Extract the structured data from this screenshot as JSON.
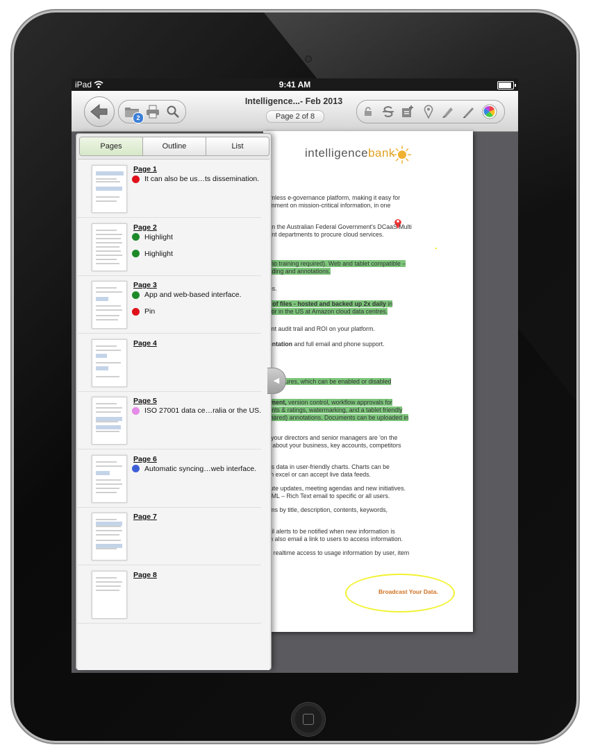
{
  "status": {
    "carrier": "iPad",
    "time": "9:41 AM"
  },
  "toolbar": {
    "title": "Intelligence...- Feb 2013",
    "page_indicator": "Page 2 of 8",
    "files_badge": "2"
  },
  "panel": {
    "tabs": [
      {
        "label": "Pages",
        "active": true
      },
      {
        "label": "Outline",
        "active": false
      },
      {
        "label": "List",
        "active": false
      }
    ],
    "pages": [
      {
        "label": "Page 1",
        "annotations": [
          {
            "text": "It can also be us…ts dissemination.",
            "color": "#e0101a"
          }
        ]
      },
      {
        "label": "Page 2",
        "annotations": [
          {
            "text": "Highlight",
            "color": "#1d8a2a"
          },
          {
            "text": "Highlight",
            "color": "#1d8a2a"
          }
        ]
      },
      {
        "label": "Page 3",
        "annotations": [
          {
            "text": "App and web-based interface.",
            "color": "#1d8a2a"
          },
          {
            "text": "Pin",
            "color": "#e0101a"
          }
        ]
      },
      {
        "label": "Page 4",
        "annotations": []
      },
      {
        "label": "Page 5",
        "annotations": [
          {
            "text": "ISO 27001 data ce…ralia or the US.",
            "color": "#e58be8"
          }
        ]
      },
      {
        "label": "Page 6",
        "annotations": [
          {
            "text": "Automatic syncing…web interface.",
            "color": "#3c5fd8"
          }
        ]
      },
      {
        "label": "Page 7",
        "annotations": []
      },
      {
        "label": "Page 8",
        "annotations": []
      }
    ]
  },
  "document": {
    "logo_a": "intelligence",
    "logo_b": "bank",
    "lines": [
      {
        "text": "eamless e-governance platform, making it easy for",
        "highlight": false,
        "bold": ""
      },
      {
        "text": "comment on mission-critical information, in one",
        "highlight": false,
        "bold": ""
      },
      {
        "text": "d on the Australian Federal Government's DCaaS Multi",
        "highlight": false,
        "bold": ""
      },
      {
        "text": "ment departments to procure cloud services.",
        "highlight": false,
        "bold": ""
      },
      {
        "text": "e (no training required).  Web and tablet compatible –",
        "highlight": true,
        "bold": ""
      },
      {
        "text": " reading and annotations.",
        "highlight": true,
        "bold": ""
      },
      {
        "text": "ures.",
        "highlight": false,
        "bold": ""
      },
      {
        "text": " in",
        "highlight": true,
        "bold": "on of files - hosted and backed up 2x daily"
      },
      {
        "text": "as or in the US at Amazon cloud data centres.",
        "highlight": true,
        "bold": ""
      },
      {
        "text": "stant audit trail and ROI on your platform.",
        "highlight": false,
        "bold": ""
      },
      {
        "text": " and full email and phone support.",
        "highlight": false,
        "bold": "mentation"
      },
      {
        "text": "and features, which can be enabled or disabled",
        "highlight": true,
        "bold": ""
      },
      {
        "text": " version control, workflow approvals for",
        "highlight": true,
        "bold": "gement,"
      },
      {
        "text": "ments & ratings, watermarking, and a tablet friendly",
        "highlight": true,
        "bold": ""
      },
      {
        "text": "r shared) annotations.  Documents can be uploaded in",
        "highlight": true,
        "bold": ""
      },
      {
        "text": "all your directors and senior managers are 'on the",
        "highlight": false,
        "bold": ""
      },
      {
        "text": "ws about your business, key accounts, competitors",
        "highlight": false,
        "bold": ""
      },
      {
        "text": "ales data in user-friendly charts.  Charts can be",
        "highlight": false,
        "bold": ""
      },
      {
        "text": "rom excel or can accept live data feeds.",
        "highlight": false,
        "bold": ""
      },
      {
        "text": "ribute updates, meeting agendas and new initiatives.",
        "highlight": false,
        "bold": ""
      },
      {
        "text": "HTML – Rich Text email to specific or all users.",
        "highlight": false,
        "bold": ""
      },
      {
        "text": " items by title, description, contents, keywords,",
        "highlight": false,
        "bold": ""
      },
      {
        "text": "mail alerts to be notified when new information is",
        "highlight": false,
        "bold": ""
      },
      {
        "text": " can also email a link to users to access information.",
        "highlight": false,
        "bold": ""
      },
      {
        "text": " realtime access to usage information by user, item",
        "highlight": false,
        "bold": "ail,"
      }
    ],
    "broadcast": "Broadcast Your Data."
  },
  "colors": {
    "highlight": "#7cc47a",
    "accent_blue": "#3d7fd6",
    "ink_yellow": "#f2f232"
  },
  "icons": [
    "back-arrow-icon",
    "folder-icon",
    "print-icon",
    "search-icon",
    "lock-icon",
    "strikethrough-icon",
    "add-note-icon",
    "pin-icon",
    "highlighter-icon",
    "pen-icon",
    "color-wheel-icon"
  ]
}
